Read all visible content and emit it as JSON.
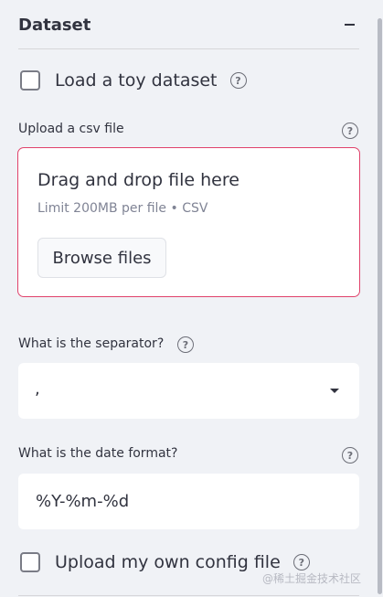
{
  "section": {
    "title": "Dataset"
  },
  "toy_dataset": {
    "label": "Load a toy dataset"
  },
  "upload": {
    "label": "Upload a csv file",
    "drag_text": "Drag and drop file here",
    "limit_text": "Limit 200MB per file • CSV",
    "browse_label": "Browse files"
  },
  "separator": {
    "label": "What is the separator?",
    "value": ","
  },
  "date_format": {
    "label": "What is the date format?",
    "value": "%Y-%m-%d"
  },
  "own_config": {
    "label": "Upload my own config file"
  },
  "help_glyph": "?",
  "watermark": "@稀土掘金技术社区",
  "colors": {
    "accent": "#e0426b",
    "background": "#f0f2f6",
    "text": "#31333f"
  }
}
